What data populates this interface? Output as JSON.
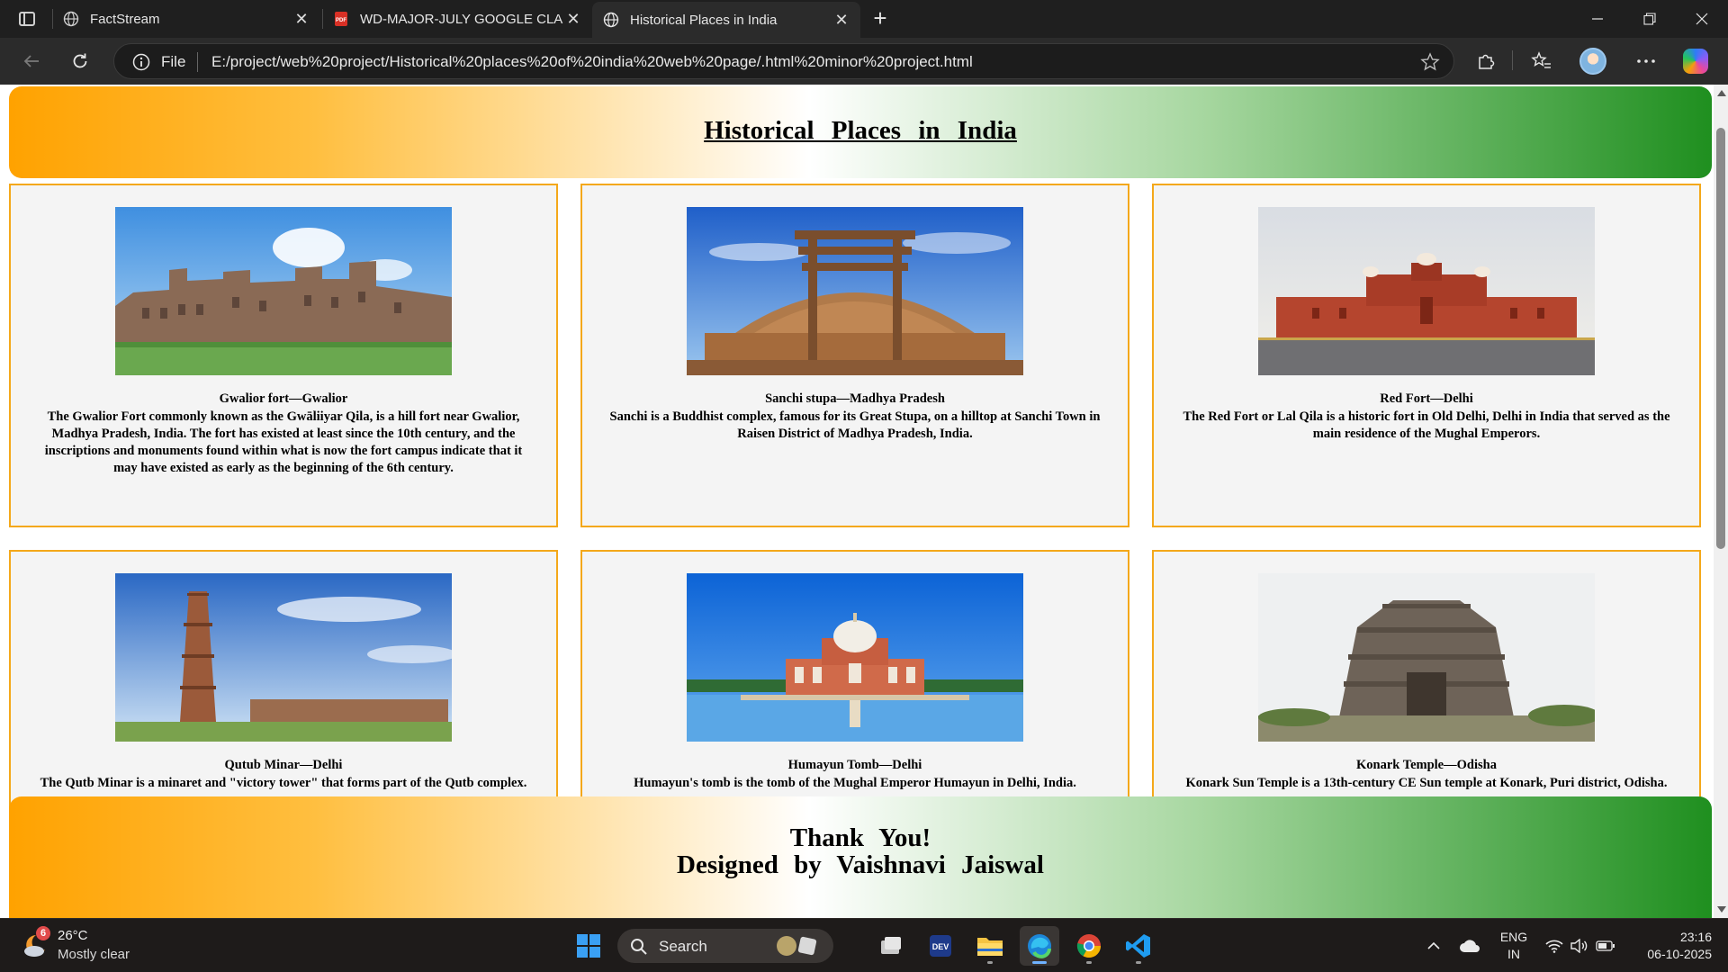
{
  "browser": {
    "tabs": [
      {
        "title": "FactStream",
        "icon": "globe-icon",
        "active": false
      },
      {
        "title": "WD-MAJOR-JULY GOOGLE CLASS",
        "icon": "pdf-icon",
        "active": false
      },
      {
        "title": "Historical Places in India",
        "icon": "globe-icon",
        "active": true
      }
    ],
    "address": {
      "scheme_label": "File",
      "url": "E:/project/web%20project/Historical%20places%20of%20india%20web%20page/.html%20minor%20project.html"
    }
  },
  "page": {
    "header_title": "Historical Places in India",
    "cards": [
      {
        "name": "Gwalior fort—Gwalior",
        "desc": "The Gwalior Fort commonly known as the Gwāliiyar Qila, is a hill fort near Gwalior, Madhya Pradesh, India. The fort has existed at least since the 10th century, and the inscriptions and monuments found within what is now the fort campus indicate that it may have existed as early as the beginning of the 6th century."
      },
      {
        "name": "Sanchi stupa—Madhya Pradesh",
        "desc": "Sanchi is a Buddhist complex, famous for its Great Stupa, on a hilltop at Sanchi Town in Raisen District of Madhya Pradesh, India."
      },
      {
        "name": "Red Fort—Delhi",
        "desc": "The Red Fort or Lal Qila is a historic fort in Old Delhi, Delhi in India that served as the main residence of the Mughal Emperors."
      },
      {
        "name": "Qutub Minar—Delhi",
        "desc": "The Qutb Minar is a minaret and \"victory tower\" that forms part of the Qutb complex."
      },
      {
        "name": "Humayun Tomb—Delhi",
        "desc": "Humayun's tomb is the tomb of the Mughal Emperor Humayun in Delhi, India."
      },
      {
        "name": "Konark Temple—Odisha",
        "desc": "Konark Sun Temple is a 13th-century CE Sun temple at Konark, Puri district, Odisha."
      }
    ],
    "footer": {
      "line1": "Thank You!",
      "line2": "Designed by Vaishnavi Jaiswal"
    }
  },
  "taskbar": {
    "weather": {
      "badge": "6",
      "temp": "26°C",
      "condition": "Mostly clear"
    },
    "search_label": "Search",
    "lang": {
      "line1": "ENG",
      "line2": "IN"
    },
    "clock": {
      "time": "23:16",
      "date": "06-10-2025"
    }
  },
  "colors": {
    "saffron": "#ffa200",
    "green": "#1f8f1f",
    "card_border": "#f4a81a",
    "card_bg": "#f4f4f4"
  }
}
